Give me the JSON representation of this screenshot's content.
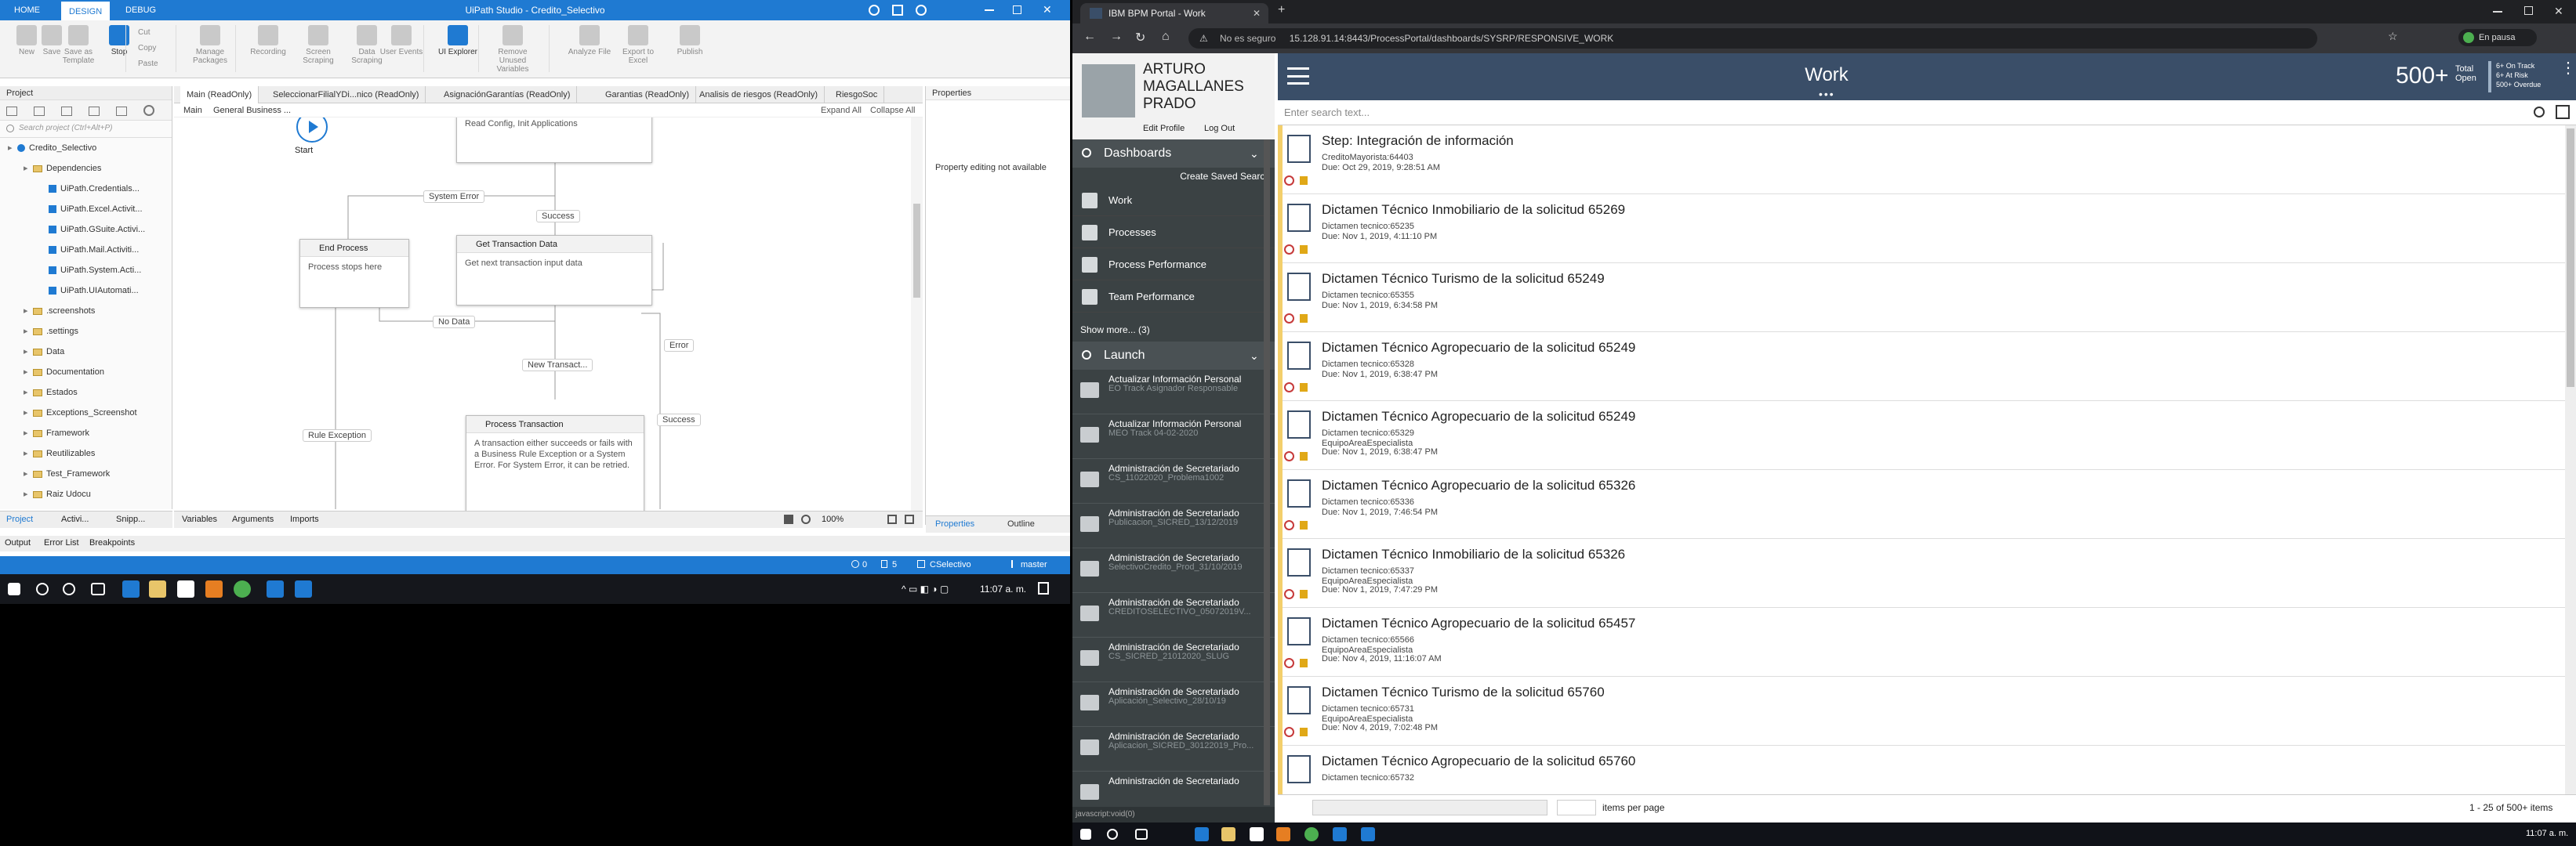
{
  "uipath": {
    "title": "UiPath Studio - Credito_Selectivo",
    "tabs": [
      "HOME",
      "DESIGN",
      "DEBUG"
    ],
    "ribbon": [
      {
        "label": "New",
        "enabled": false
      },
      {
        "label": "Save",
        "enabled": false
      },
      {
        "label": "Save as Template",
        "enabled": false
      },
      {
        "label": "Stop",
        "enabled": true
      },
      {
        "label": "Cut",
        "enabled": false
      },
      {
        "label": "Copy",
        "enabled": false
      },
      {
        "label": "Paste",
        "enabled": false
      },
      {
        "label": "Manage Packages",
        "enabled": false
      },
      {
        "label": "Recording",
        "enabled": false
      },
      {
        "label": "Screen Scraping",
        "enabled": false
      },
      {
        "label": "Data Scraping",
        "enabled": false
      },
      {
        "label": "User Events",
        "enabled": false
      },
      {
        "label": "UI Explorer",
        "enabled": true
      },
      {
        "label": "Remove Unused Variables",
        "enabled": false
      },
      {
        "label": "Analyze File",
        "enabled": false
      },
      {
        "label": "Export to Excel",
        "enabled": false
      },
      {
        "label": "Publish",
        "enabled": false
      }
    ],
    "project_title": "Project",
    "project_search": "Search project (Ctrl+Alt+P)",
    "tree": [
      {
        "label": "Credito_Selectivo",
        "level": 0,
        "kind": "root"
      },
      {
        "label": "Dependencies",
        "level": 1,
        "kind": "folder"
      },
      {
        "label": "UiPath.Credentials...",
        "level": 2,
        "kind": "dep"
      },
      {
        "label": "UiPath.Excel.Activit...",
        "level": 2,
        "kind": "dep"
      },
      {
        "label": "UiPath.GSuite.Activi...",
        "level": 2,
        "kind": "dep"
      },
      {
        "label": "UiPath.Mail.Activiti...",
        "level": 2,
        "kind": "dep"
      },
      {
        "label": "UiPath.System.Acti...",
        "level": 2,
        "kind": "dep"
      },
      {
        "label": "UiPath.UIAutomati...",
        "level": 2,
        "kind": "dep"
      },
      {
        "label": ".screenshots",
        "level": 1,
        "kind": "folder"
      },
      {
        "label": ".settings",
        "level": 1,
        "kind": "folder"
      },
      {
        "label": "Data",
        "level": 1,
        "kind": "folder"
      },
      {
        "label": "Documentation",
        "level": 1,
        "kind": "folder"
      },
      {
        "label": "Estados",
        "level": 1,
        "kind": "folder"
      },
      {
        "label": "Exceptions_Screenshot",
        "level": 1,
        "kind": "folder"
      },
      {
        "label": "Framework",
        "level": 1,
        "kind": "folder"
      },
      {
        "label": "Reutilizables",
        "level": 1,
        "kind": "folder"
      },
      {
        "label": "Test_Framework",
        "level": 1,
        "kind": "folder"
      },
      {
        "label": "Raiz Udocu",
        "level": 1,
        "kind": "folder"
      }
    ],
    "doc_tabs": [
      "Main (ReadOnly)",
      "SeleccionarFilialYDi...nico (ReadOnly)",
      "AsignaciónGarantías (ReadOnly)",
      "Garantias (ReadOnly)",
      "Analisis de riesgos (ReadOnly)",
      "RiesgoSoc"
    ],
    "breadcrumb": [
      "Main",
      "General Business ..."
    ],
    "expand_all": "Expand All",
    "collapse_all": "Collapse All",
    "flow": {
      "start": "Start",
      "init_text": "Read Config, Init Applications",
      "end_title": "End Process",
      "end_text": "Process stops here",
      "get_title": "Get Transaction Data",
      "get_text": "Get next transaction input data",
      "proc_title": "Process Transaction",
      "proc_text": "A transaction either succeeds or fails with a Business Rule Exception or a System Error. For System Error, it can be retried.",
      "labels": [
        "System Error",
        "Success",
        "No Data",
        "New Transact...",
        "Error",
        "Rule Exception",
        "Success"
      ]
    },
    "props_title": "Properties",
    "props_msg": "Property editing not available",
    "canvas_tabs": [
      "Variables",
      "Arguments",
      "Imports"
    ],
    "zoom": "100%",
    "panel_tabs": [
      "Project",
      "Activi...",
      "Snipp..."
    ],
    "props_tabs": [
      "Properties",
      "Outline"
    ],
    "output_tabs": [
      "Output",
      "Error List",
      "Breakpoints"
    ],
    "status": {
      "errors": "0",
      "changes": "5",
      "repo": "CSelectivo",
      "branch": "master"
    }
  },
  "taskbar_left": {
    "time": "11:07 a. m."
  },
  "chrome": {
    "tab_title": "IBM BPM Portal - Work",
    "security": "No es seguro",
    "url": "15.128.91.14:8443/ProcessPortal/dashboards/SYSRP/RESPONSIVE_WORK",
    "profile": "En pausa"
  },
  "bpm": {
    "user_name": "ARTURO MAGALLANES PRADO",
    "edit_profile": "Edit Profile",
    "logout": "Log Out",
    "dashboards_title": "Dashboards",
    "create_saved_search": "Create Saved Search",
    "nav": [
      {
        "label": "Work",
        "icon": "inbox-icon"
      },
      {
        "label": "Processes",
        "icon": "processes-icon"
      },
      {
        "label": "Process Performance",
        "icon": "chart-icon"
      },
      {
        "label": "Team Performance",
        "icon": "team-icon"
      }
    ],
    "show_more": "Show more... (3)",
    "launch_title": "Launch",
    "launch": [
      {
        "title": "Actualizar Información Personal",
        "sub": "EO Track Asignador Responsable"
      },
      {
        "title": "Actualizar Información Personal",
        "sub": "MEO Track 04-02-2020"
      },
      {
        "title": "Administración de Secretariado",
        "sub": "CS_11022020_Problema1002"
      },
      {
        "title": "Administración de Secretariado",
        "sub": "Publicacion_SICRED_13/12/2019"
      },
      {
        "title": "Administración de Secretariado",
        "sub": "SelectivoCredito_Prod_31/10/2019"
      },
      {
        "title": "Administración de Secretariado",
        "sub": "CREDITOSELECTIVO_05072019V..."
      },
      {
        "title": "Administración de Secretariado",
        "sub": "CS_SICRED_21012020_SLUG"
      },
      {
        "title": "Administración de Secretariado",
        "sub": "Aplicación_Selectivo_28/10/19"
      },
      {
        "title": "Administración de Secretariado",
        "sub": "Aplicacion_SICRED_30122019_Pro..."
      },
      {
        "title": "Administración de Secretariado",
        "sub": ""
      }
    ],
    "header_title": "Work",
    "total_count": "500+",
    "total_label": "Total Open",
    "stats": [
      "6+ On Track",
      "6+ At Risk",
      "500+ Overdue"
    ],
    "search_placeholder": "Enter search text...",
    "items": [
      {
        "title": "Step: Integración de información",
        "sub": "CreditoMayorista:64403",
        "team": "",
        "due": "Due: Oct 29, 2019, 9:28:51 AM"
      },
      {
        "title": "Dictamen Técnico Inmobiliario de la solicitud 65269",
        "sub": "Dictamen tecnico:65235",
        "team": "",
        "due": "Due: Nov 1, 2019, 4:11:10 PM"
      },
      {
        "title": "Dictamen Técnico Turismo de la solicitud 65249",
        "sub": "Dictamen tecnico:65355",
        "team": "",
        "due": "Due: Nov 1, 2019, 6:34:58 PM"
      },
      {
        "title": "Dictamen Técnico Agropecuario de la solicitud 65249",
        "sub": "Dictamen tecnico:65328",
        "team": "",
        "due": "Due: Nov 1, 2019, 6:38:47 PM"
      },
      {
        "title": "Dictamen Técnico Agropecuario de la solicitud 65249",
        "sub": "Dictamen tecnico:65329",
        "team": "EquipoAreaEspecialista",
        "due": "Due: Nov 1, 2019, 6:38:47 PM"
      },
      {
        "title": "Dictamen Técnico Agropecuario de la solicitud 65326",
        "sub": "Dictamen tecnico:65336",
        "team": "",
        "due": "Due: Nov 1, 2019, 7:46:54 PM"
      },
      {
        "title": "Dictamen Técnico Inmobiliario de la solicitud 65326",
        "sub": "Dictamen tecnico:65337",
        "team": "EquipoAreaEspecialista",
        "due": "Due: Nov 1, 2019, 7:47:29 PM"
      },
      {
        "title": "Dictamen Técnico Agropecuario de la solicitud 65457",
        "sub": "Dictamen tecnico:65566",
        "team": "EquipoAreaEspecialista",
        "due": "Due: Nov 4, 2019, 11:16:07 AM"
      },
      {
        "title": "Dictamen Técnico Turismo de la solicitud 65760",
        "sub": "Dictamen tecnico:65731",
        "team": "EquipoAreaEspecialista",
        "due": "Due: Nov 4, 2019, 7:02:48 PM"
      },
      {
        "title": "Dictamen Técnico Agropecuario de la solicitud 65760",
        "sub": "Dictamen tecnico:65732",
        "team": "",
        "due": ""
      }
    ],
    "items_per_page": "items per page",
    "range": "1 - 25 of 500+ items",
    "status_url": "javascript:void(0)"
  },
  "taskbar_right": {
    "time": "11:07 a. m."
  }
}
